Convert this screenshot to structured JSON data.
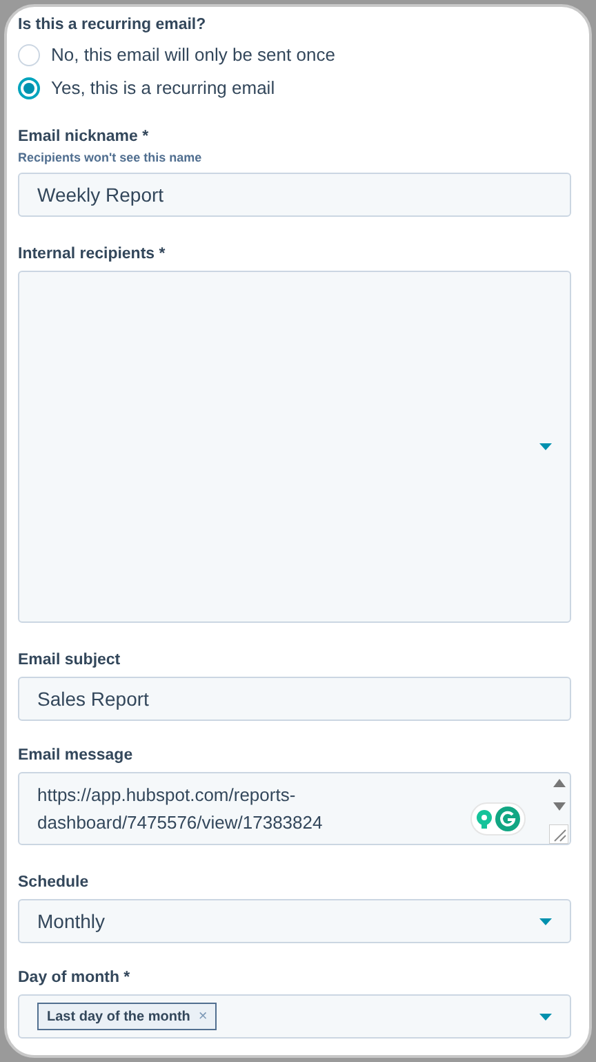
{
  "recurring": {
    "label": "Is this a recurring email?",
    "options": [
      {
        "label": "No, this email will only be sent once",
        "selected": false
      },
      {
        "label": "Yes, this is a recurring email",
        "selected": true
      }
    ]
  },
  "nickname": {
    "label": "Email nickname *",
    "hint": "Recipients won't see this name",
    "value": "Weekly Report"
  },
  "recipients": {
    "label": "Internal recipients *"
  },
  "subject": {
    "label": "Email subject",
    "value": "Sales Report"
  },
  "message": {
    "label": "Email message",
    "value": "https://app.hubspot.com/reports-dashboard/7475576/view/17383824"
  },
  "schedule": {
    "label": "Schedule",
    "value": "Monthly"
  },
  "day_of_month": {
    "label": "Day of month *",
    "tags": [
      "Last day of the month"
    ],
    "remove_symbol": "×"
  }
}
